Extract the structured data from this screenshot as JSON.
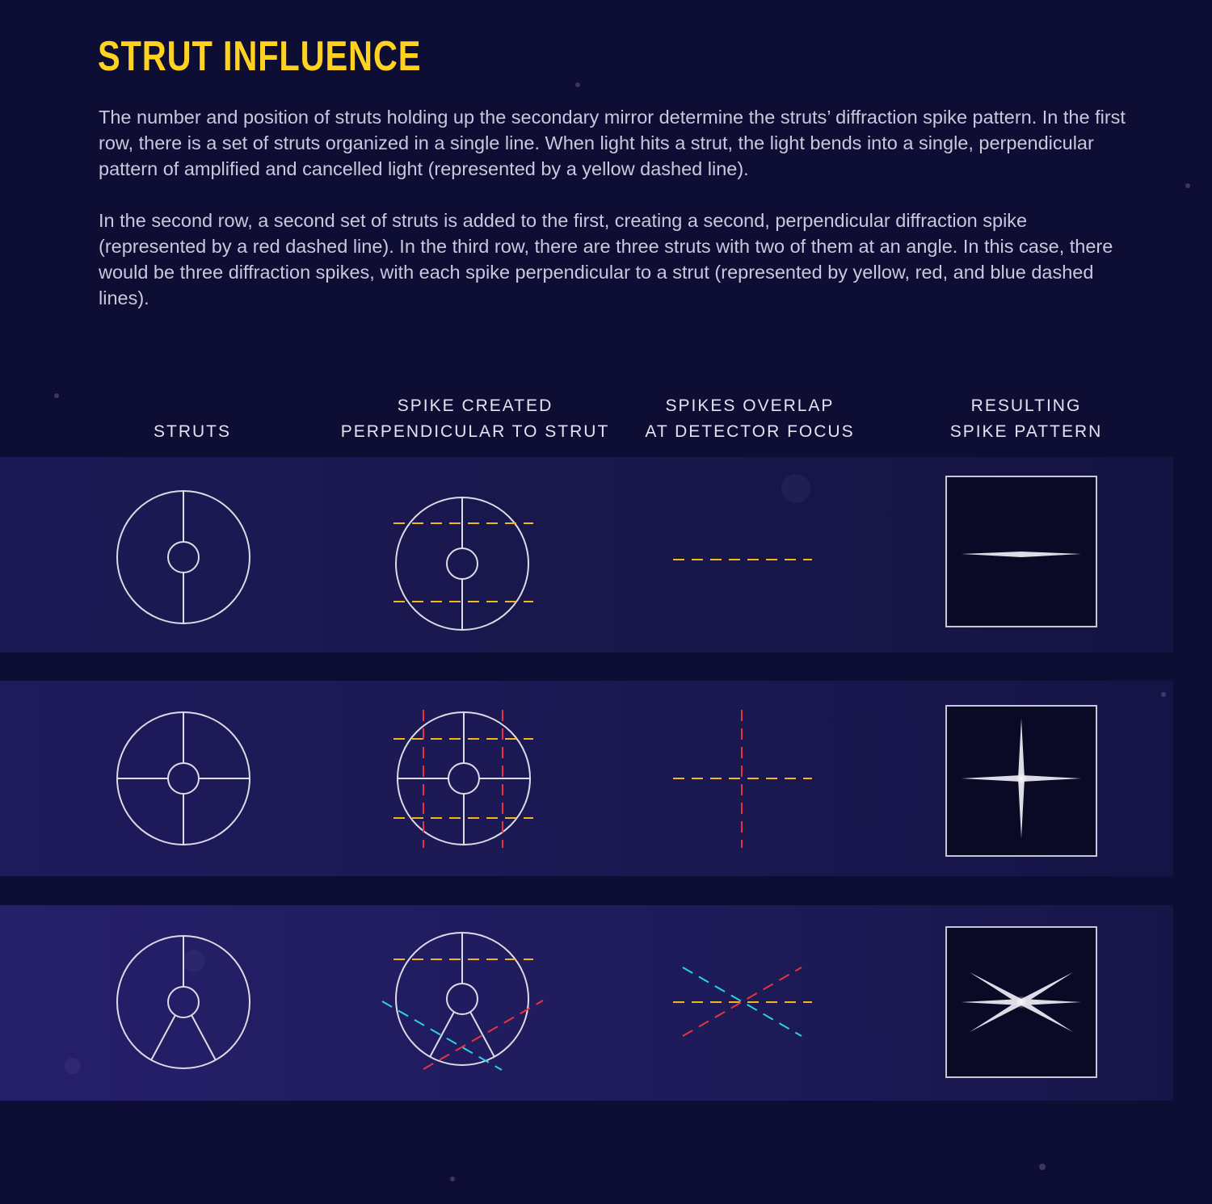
{
  "title": "STRUT INFLUENCE",
  "paragraphs": [
    "The number and position of struts holding up the secondary mirror determine the struts’ diffraction spike pattern. In the first row, there is a set of struts organized in a single line. When light hits a strut, the light bends into a single, perpendicular pattern of amplified and cancelled light (represented by a yellow dashed line).",
    "In the second row, a second set of struts is added to the first, creating a second, perpendicular diffraction spike (represented by a red dashed line). In the third row, there are three struts with two of them at an angle. In this case, there would be three diffraction spikes, with each spike perpendicular to a strut (represented by yellow, red, and blue dashed lines)."
  ],
  "columns": [
    {
      "lines": [
        "STRUTS"
      ]
    },
    {
      "lines": [
        "SPIKE CREATED",
        "PERPENDICULAR TO STRUT"
      ]
    },
    {
      "lines": [
        "SPIKES OVERLAP",
        "AT DETECTOR FOCUS"
      ]
    },
    {
      "lines": [
        "RESULTING",
        "SPIKE PATTERN"
      ]
    }
  ],
  "colors": {
    "background": "#0e0d33",
    "title": "#ffd21f",
    "yellow_spike": "#f2b71c",
    "red_spike": "#e8343f",
    "blue_spike": "#2ad3e0",
    "outline": "#dcdbe6"
  }
}
